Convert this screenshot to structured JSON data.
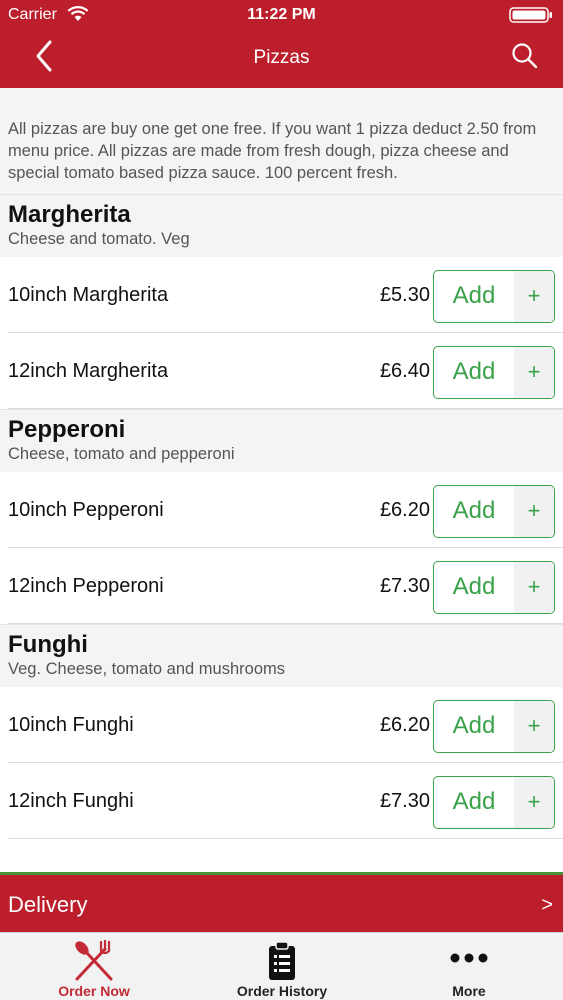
{
  "status_bar": {
    "carrier": "Carrier",
    "time": "11:22 PM"
  },
  "nav": {
    "title": "Pizzas",
    "back_icon": "chevron-left-icon",
    "search_icon": "search-icon"
  },
  "intro": "All pizzas are buy one get one free. If you want 1 pizza deduct 2.50 from menu price. All pizzas are made from fresh dough, pizza cheese and special tomato based pizza sauce. 100 percent fresh.",
  "add_label": "Add",
  "add_plus": "+",
  "sections": [
    {
      "title": "Margherita",
      "desc": "Cheese and tomato. Veg",
      "items": [
        {
          "name": "10inch Margherita",
          "price": "£5.30"
        },
        {
          "name": "12inch Margherita",
          "price": "£6.40"
        }
      ]
    },
    {
      "title": "Pepperoni",
      "desc": "Cheese, tomato and pepperoni",
      "items": [
        {
          "name": "10inch Pepperoni",
          "price": "£6.20"
        },
        {
          "name": "12inch Pepperoni",
          "price": "£7.30"
        }
      ]
    },
    {
      "title": "Funghi",
      "desc": "Veg. Cheese, tomato and mushrooms",
      "items": [
        {
          "name": "10inch Funghi",
          "price": "£6.20"
        },
        {
          "name": "12inch Funghi",
          "price": "£7.30"
        }
      ]
    }
  ],
  "delivery": {
    "label": "Delivery",
    "arrow": ">"
  },
  "tabs": [
    {
      "label": "Order Now",
      "icon": "fork-knife-icon",
      "active": true
    },
    {
      "label": "Order History",
      "icon": "clipboard-icon",
      "active": false
    },
    {
      "label": "More",
      "icon": "more-dots-icon",
      "active": false
    }
  ],
  "colors": {
    "brand_red": "#bd1e2b",
    "accent_green": "#3aa24a",
    "active_tab": "#c22a36"
  }
}
